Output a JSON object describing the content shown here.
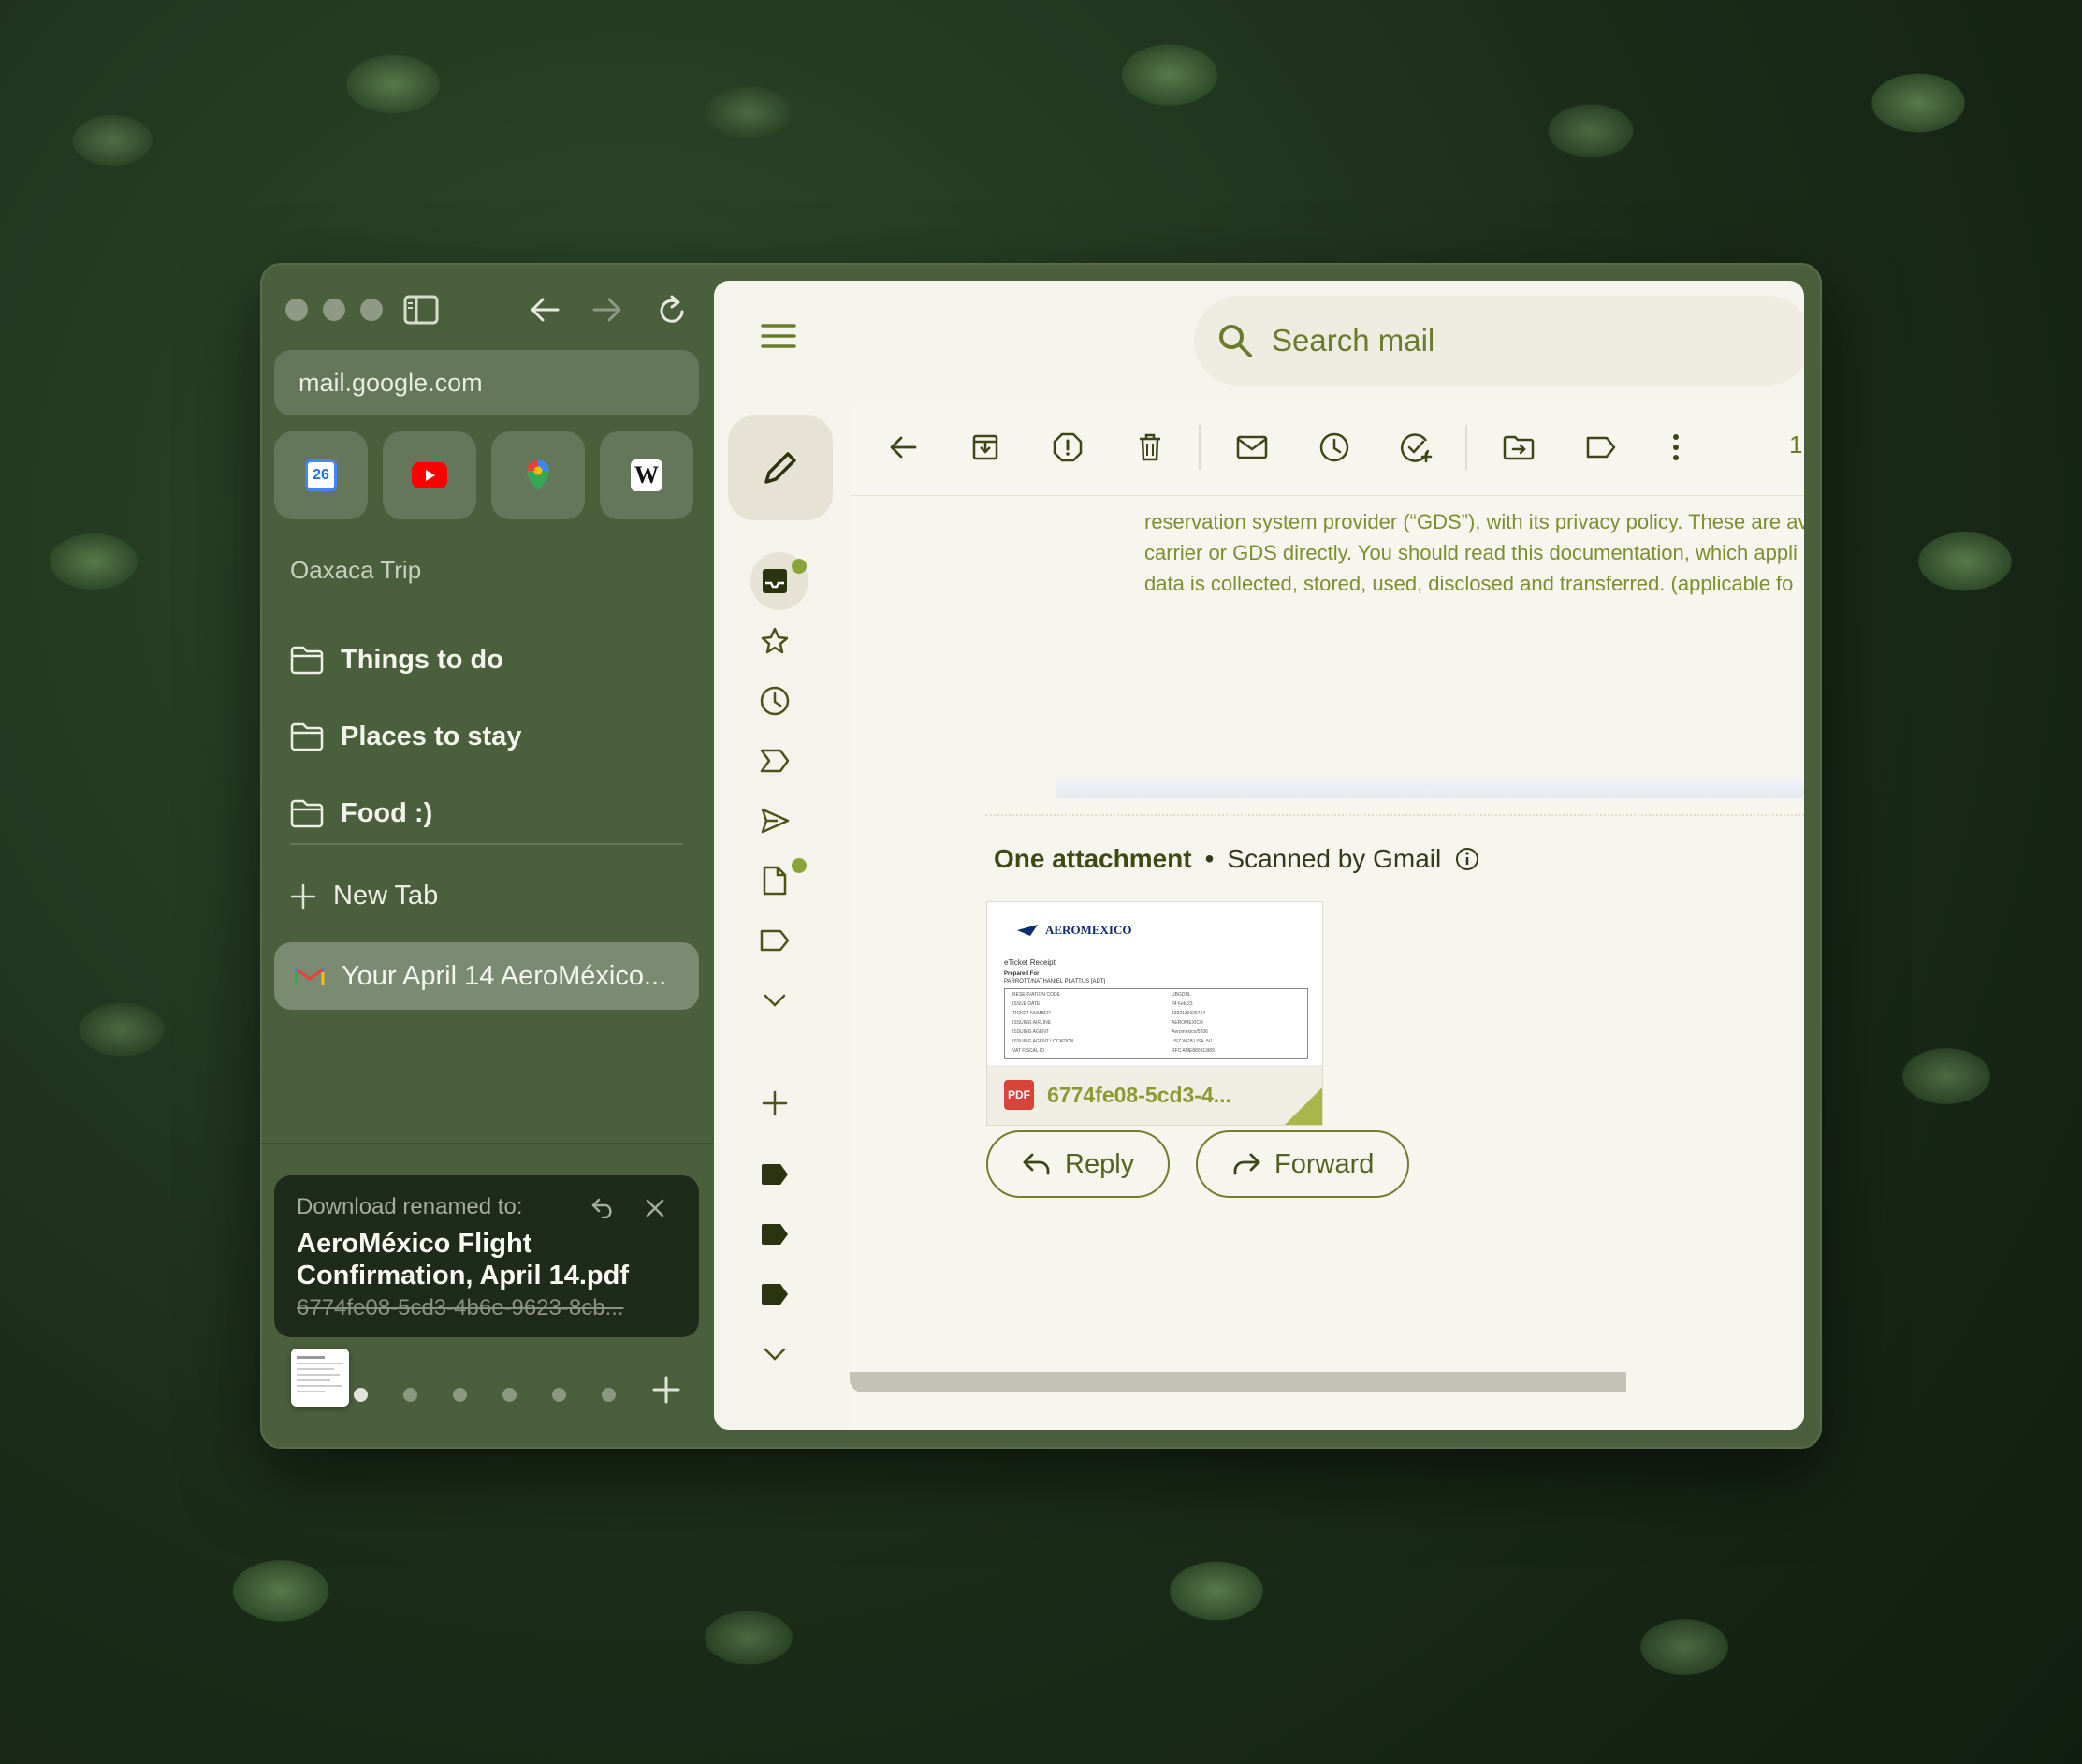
{
  "browser": {
    "url": "mail.google.com",
    "favorites": [
      {
        "name": "Google Calendar",
        "icon": "calendar-icon",
        "label": "26"
      },
      {
        "name": "YouTube",
        "icon": "youtube-icon",
        "label": ""
      },
      {
        "name": "Google Maps",
        "icon": "maps-icon",
        "label": ""
      },
      {
        "name": "Wikipedia",
        "icon": "wikipedia-icon",
        "label": "W"
      }
    ],
    "space_title": "Oaxaca Trip",
    "folders": [
      "Things to do",
      "Places to stay",
      "Food :)"
    ],
    "new_tab_label": "New Tab",
    "active_tab": "Your April 14 AeroMéxico...",
    "toast": {
      "heading": "Download renamed to:",
      "new_name": "AeroMéxico Flight Confirmation, April 14.pdf",
      "old_name": "6774fe08-5cd3-4b6e-9623-8cb..."
    },
    "colors": {
      "sidebar": "#4a5f3c",
      "accent": "#6a7b2c",
      "dot": "#8aa43a"
    }
  },
  "gmail": {
    "search_placeholder": "Search mail",
    "page_indicator": "1",
    "body_lines": [
      "reservation system provider (“GDS”), with its privacy policy. These are av",
      "carrier or GDS directly. You should read this documentation, which appli",
      "data is collected, stored, used, disclosed and transferred. (applicable fo"
    ],
    "attachment": {
      "heading": "One attachment",
      "scanned": "Scanned by Gmail",
      "filename": "6774fe08-5cd3-4...",
      "badge": "PDF",
      "preview": {
        "brand": "AEROMEXICO",
        "doc_title": "eTicket Receipt",
        "prepared_for": "Prepared For",
        "passenger": "PARROTT/NATHANIEL PLATTUS [ADT]",
        "rows": [
          [
            "RESERVATION CODE",
            "UBGDRL"
          ],
          [
            "ISSUE DATE",
            "24 Feb 23"
          ],
          [
            "TICKET NUMBER",
            "1392136026714"
          ],
          [
            "ISSUING AIRLINE",
            "AEROMEXICO"
          ],
          [
            "ISSUING AGENT",
            "Aeromexico/5206"
          ],
          [
            "ISSUING AGENT LOCATION",
            "USZ WEB USA, NJ"
          ],
          [
            "VAT FISCAL ID",
            "RFC AME880913I89"
          ]
        ]
      }
    },
    "reply_label": "Reply",
    "forward_label": "Forward"
  }
}
